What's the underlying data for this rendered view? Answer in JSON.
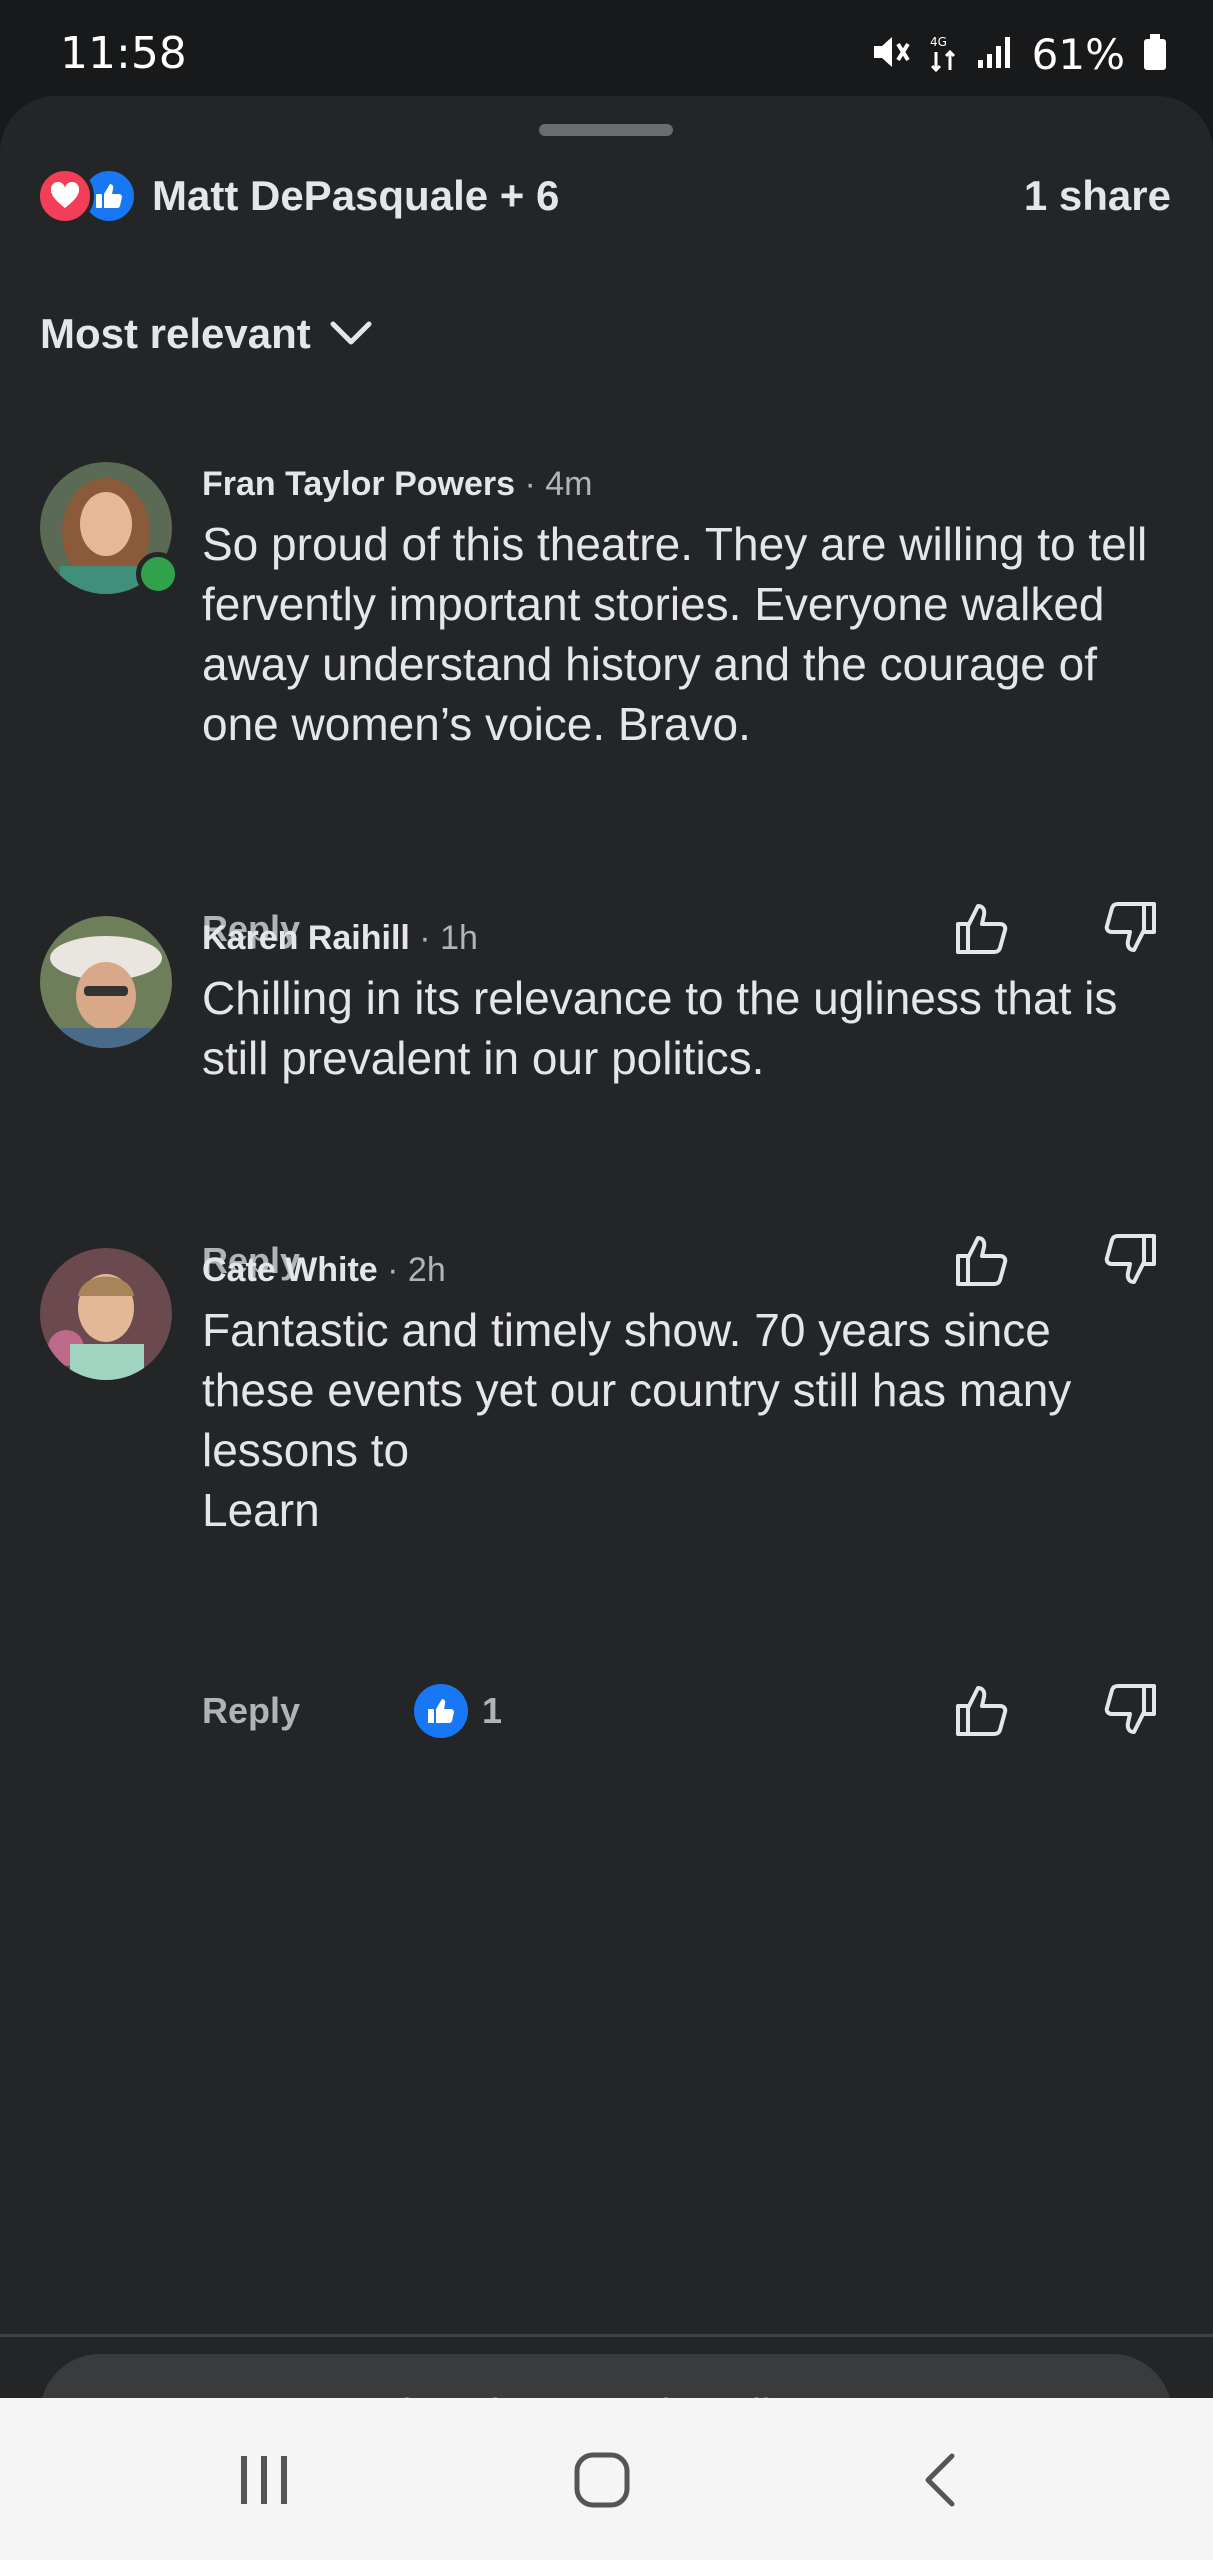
{
  "status_bar": {
    "time": "11:58",
    "battery": "61%"
  },
  "reactions": {
    "reactors": "Matt DePasquale + 6",
    "shares": "1 share"
  },
  "sort": {
    "label": "Most relevant"
  },
  "comments": [
    {
      "author": "Fran Taylor Powers",
      "time": "· 4m",
      "text": "So proud of this theatre. They are willing to tell fervently important stories.  Everyone walked away  understand history and the courage of one women’s voice. Bravo.",
      "reply": "Reply",
      "online": true
    },
    {
      "author": "Karen Raihill",
      "time": "· 1h",
      "text": "Chilling in its relevance to the ugliness that is still prevalent in our politics.",
      "reply": "Reply"
    },
    {
      "author": "Cate White",
      "time": "· 2h",
      "text": "Fantastic and timely show. 70 years since these events yet our country still has many lessons to\nLearn",
      "reply": "Reply",
      "like_count": "1"
    }
  ],
  "composer": {
    "placeholder": "Comment as Deborah Bostock-Kelley"
  },
  "colors": {
    "background": "#242527",
    "accent": "#1877f2",
    "love": "#f33e58",
    "online": "#31a24c"
  },
  "icons": [
    "mute-icon",
    "data-icon",
    "signal-icon",
    "battery-icon",
    "love-reaction-icon",
    "like-reaction-icon",
    "chevron-down-icon",
    "thumb-up-icon",
    "thumb-down-icon",
    "recents-icon",
    "home-icon",
    "back-icon"
  ]
}
